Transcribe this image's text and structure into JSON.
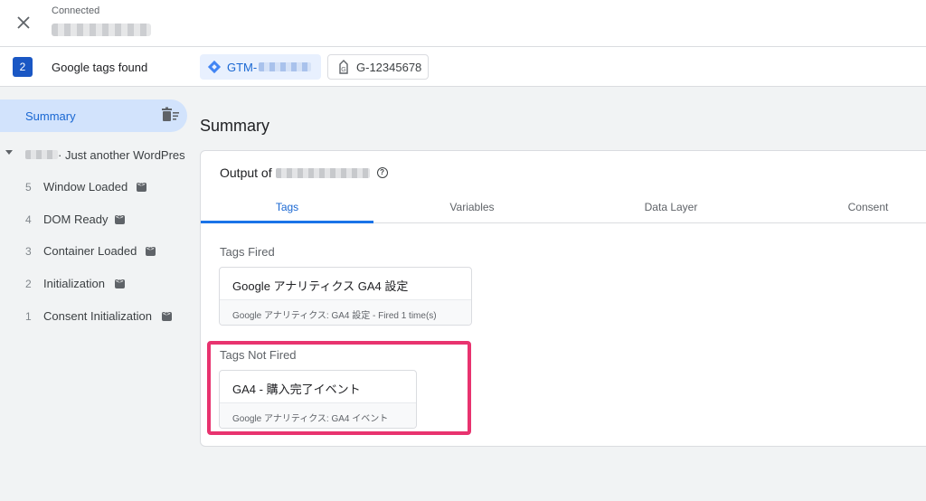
{
  "header": {
    "status": "Connected",
    "site_name_redacted": ""
  },
  "tags_bar": {
    "count": "2",
    "label": "Google tags found",
    "chips": [
      {
        "prefix": "GTM-",
        "icon": "gtm-diamond-icon"
      },
      {
        "label": "G-12345678",
        "icon": "ga-tag-icon"
      }
    ]
  },
  "sidebar": {
    "summary_label": "Summary",
    "page_title": "· Just another WordPres",
    "events": [
      {
        "num": "5",
        "label": "Window Loaded"
      },
      {
        "num": "4",
        "label": "DOM Ready"
      },
      {
        "num": "3",
        "label": "Container Loaded"
      },
      {
        "num": "2",
        "label": "Initialization"
      },
      {
        "num": "1",
        "label": "Consent Initialization"
      }
    ]
  },
  "main": {
    "title": "Summary",
    "output_label": "Output of",
    "tabs": [
      "Tags",
      "Variables",
      "Data Layer",
      "Consent"
    ],
    "active_tab": "Tags",
    "fired": {
      "label": "Tags Fired",
      "tag_name": "Google アナリティクス GA4 設定",
      "tag_sub": "Google アナリティクス: GA4 設定 - Fired 1 time(s)"
    },
    "not_fired": {
      "label": "Tags Not Fired",
      "tag_name": "GA4 - 購入完了イベント",
      "tag_sub": "Google アナリティクス: GA4 イベント"
    }
  },
  "colors": {
    "accent": "#1a73e8",
    "highlight": "#e8336f",
    "selected_bg": "#d2e3fc"
  }
}
